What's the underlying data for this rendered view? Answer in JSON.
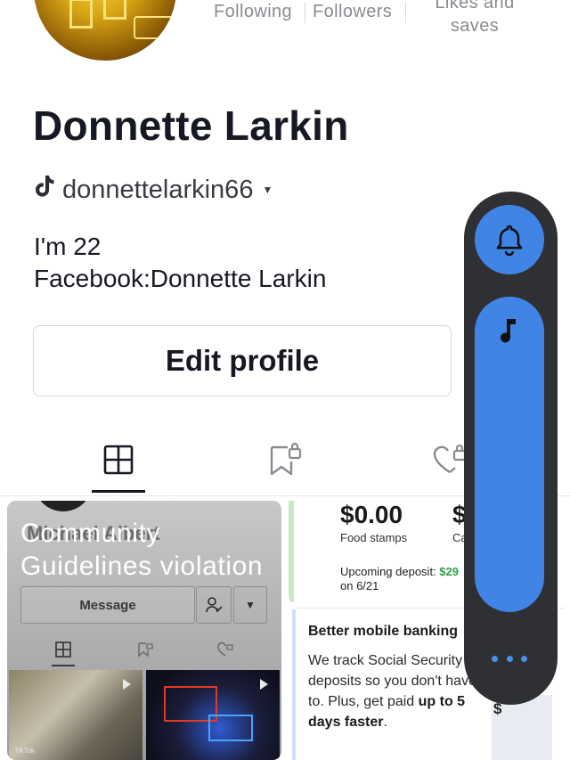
{
  "profile": {
    "stats": {
      "following_label": "Following",
      "followers_label": "Followers",
      "likes_label_line1": "Likes and",
      "likes_label_line2": "saves"
    },
    "display_name": "Donnette Larkin",
    "username": "donnettelarkin66",
    "bio_line1": "I'm 22",
    "bio_line2": "Facebook:Donnette Larkin",
    "edit_button": "Edit profile"
  },
  "tabs": [
    {
      "icon": "grid-icon",
      "selected": true
    },
    {
      "icon": "bookmark-lock-icon",
      "selected": false
    },
    {
      "icon": "heart-lock-icon",
      "selected": false
    }
  ],
  "posts": {
    "post1": {
      "overlay_line1": "Community",
      "overlay_line2": "Guidelines violation",
      "background_name": "Michael Albert",
      "message_button": "Message",
      "watermark": "TikTok"
    },
    "post2": {
      "balance": "$0.00",
      "balance2": "$",
      "food_label": "Food stamps",
      "cash_label": "Ca",
      "upcoming_prefix": "Upcoming deposit: ",
      "upcoming_amount": "$29",
      "upcoming_date": "on 6/21",
      "card_title": "Better mobile banking",
      "card_body_start": "We track Social Security deposits so you don't have to. Plus, get paid ",
      "card_body_bold": "up to 5 days faster",
      "card_body_end": "."
    }
  },
  "floating_panel": {
    "bell_icon": "bell-icon",
    "music_icon": "music-note-icon",
    "more_icon": "more-dots-icon",
    "accent_color": "#4085e6"
  }
}
